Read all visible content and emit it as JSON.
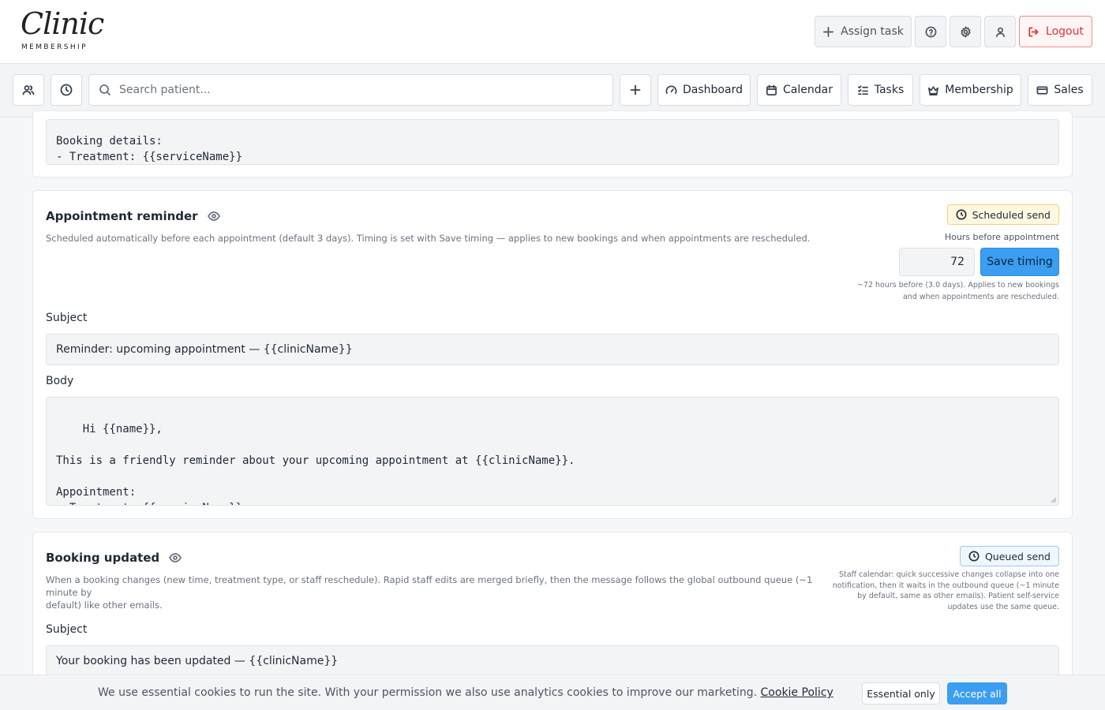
{
  "header": {
    "logo_script": "Clinic",
    "logo_sub": "MEMBERSHIP",
    "assign_task_label": "Assign task",
    "logout_label": "Logout"
  },
  "nav": {
    "search_placeholder": "Search patient...",
    "dashboard_label": "Dashboard",
    "calendar_label": "Calendar",
    "tasks_label": "Tasks",
    "membership_label": "Membership",
    "sales_label": "Sales"
  },
  "top_card": {
    "body_text": "Booking details:\n- Treatment: {{serviceName}}\n- Date & time: {{appointmentDateTime}}"
  },
  "reminder_card": {
    "title": "Appointment reminder",
    "description": "Scheduled automatically before each appointment (default 3 days). Timing is set with Save timing — applies to new bookings and when appointments are rescheduled.",
    "badge": "Scheduled send",
    "hours_label": "Hours before appointment",
    "hours_value": "72",
    "save_label": "Save timing",
    "hint_line1": "~72 hours before (3.0 days). Applies to new bookings",
    "hint_line2": "and when appointments are rescheduled.",
    "subject_label": "Subject",
    "subject_value": "Reminder: upcoming appointment — {{clinicName}}",
    "body_label": "Body",
    "body_text": "Hi {{name}},\n\nThis is a friendly reminder about your upcoming appointment at {{clinicName}}.\n\nAppointment:\n- Treatment: {{serviceName}}\n- Date & time: {{appointmentDateTime}}"
  },
  "updated_card": {
    "title": "Booking updated",
    "description_line1": "When a booking changes (new time, treatment type, or staff reschedule). Rapid staff edits are merged briefly, then the message follows the global outbound queue (~1 minute by",
    "description_line2": "default) like other emails.",
    "badge": "Queued send",
    "hint_line1": "Staff calendar: quick successive changes collapse into one",
    "hint_line2": "notification, then it waits in the outbound queue (~1 minute",
    "hint_line3": "by default, same as other emails). Patient self-service",
    "hint_line4": "updates use the same queue.",
    "subject_label": "Subject",
    "subject_value": "Your booking has been updated — {{clinicName}}"
  },
  "cookie": {
    "text": "We use essential cookies to run the site. With your permission we also use analytics cookies to improve our marketing.",
    "link": "Cookie Policy",
    "essential_label": "Essential only",
    "accept_label": "Accept all"
  },
  "colors": {
    "accent": "#3b9ef0",
    "logout": "#e3342f",
    "scheduled_badge_bg": "#fff8e1",
    "queued_badge_bg": "#eef6ff"
  }
}
